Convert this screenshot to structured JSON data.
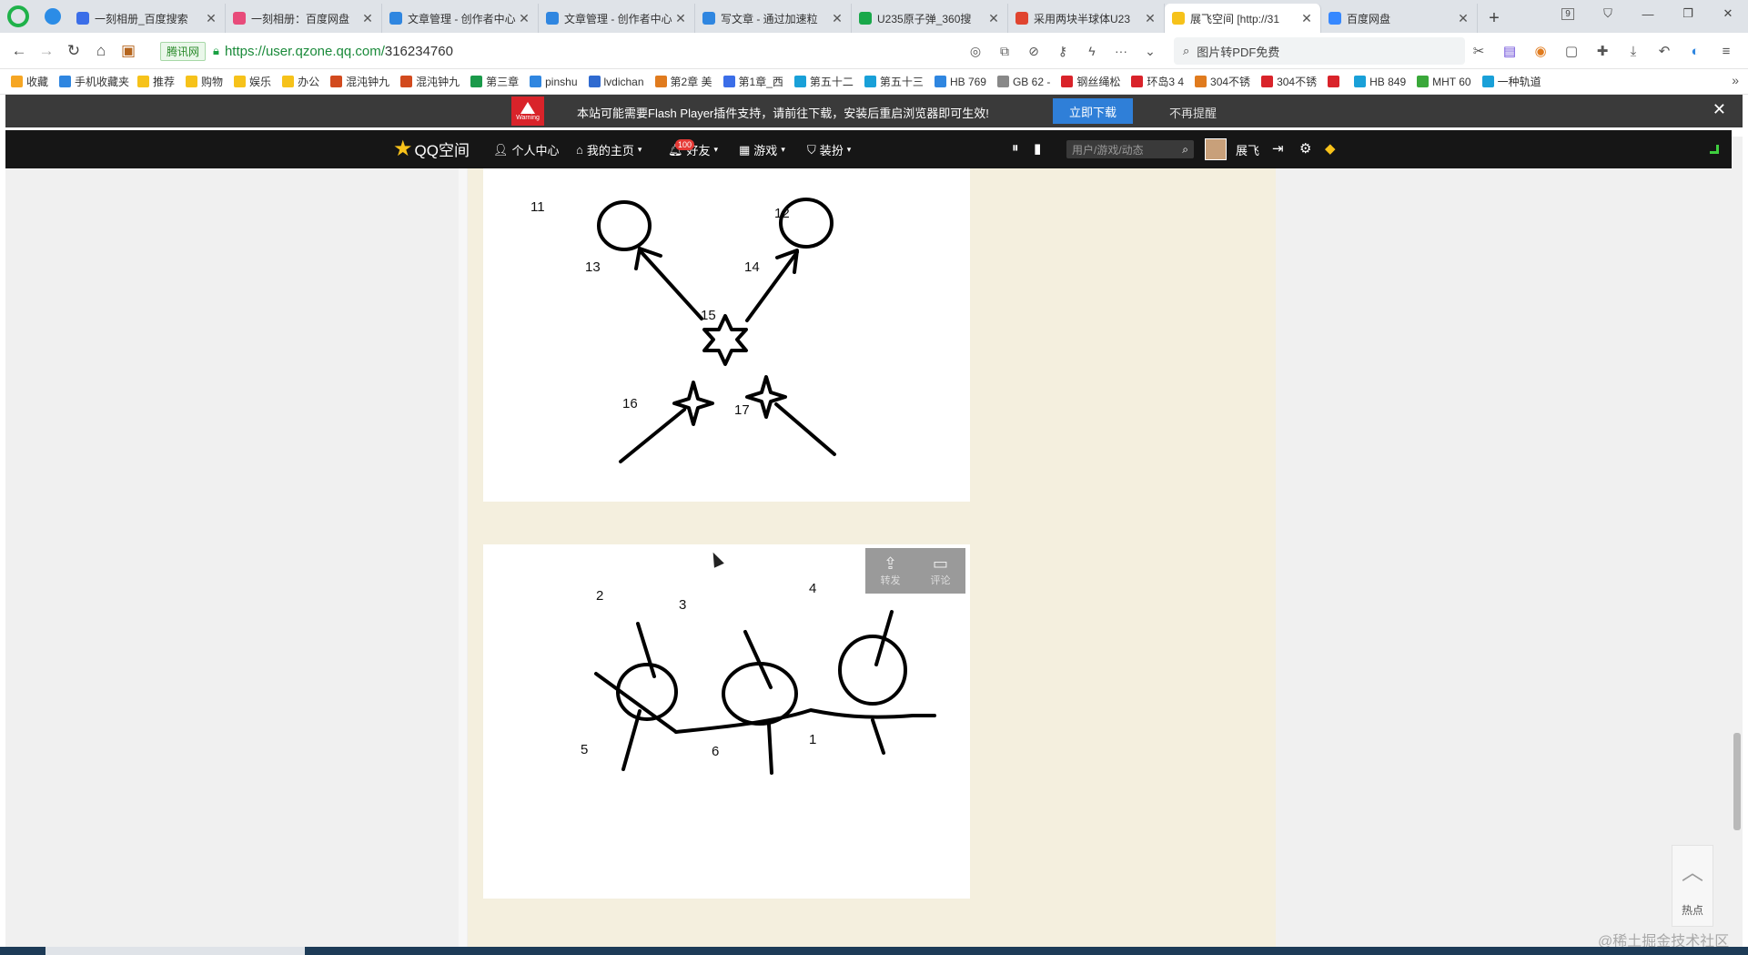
{
  "tabs": [
    {
      "title": "一刻相册_百度搜索",
      "color": "#3b6ee8",
      "active": false
    },
    {
      "title": "一刻相册：百度网盘",
      "color": "#e84b7a",
      "active": false
    },
    {
      "title": "文章管理 - 创作者中心",
      "color": "#2f86e0",
      "active": false
    },
    {
      "title": "文章管理 - 创作者中心",
      "color": "#2f86e0",
      "active": false
    },
    {
      "title": "写文章 - 通过加速粒",
      "color": "#2f86e0",
      "active": false
    },
    {
      "title": "U235原子弹_360搜",
      "color": "#19a84a",
      "active": false
    },
    {
      "title": "采用两块半球体U23",
      "color": "#e0442f",
      "active": false
    },
    {
      "title": "展飞空间 [http://31",
      "color": "#f6c21a",
      "active": true
    },
    {
      "title": "百度网盘",
      "color": "#3688ff",
      "active": false
    }
  ],
  "tab_counter": "9",
  "address": {
    "cert_label": "腾讯网",
    "url_host": "https://user.qzone.qq.com/",
    "url_path": "316234760",
    "search_text": "图片转PDF免费"
  },
  "bookmarks": [
    {
      "label": "收藏",
      "color": "#f6a623"
    },
    {
      "label": "手机收藏夹",
      "color": "#2f86e0"
    },
    {
      "label": "推荐",
      "color": "#f6c21a"
    },
    {
      "label": "购物",
      "color": "#f6c21a"
    },
    {
      "label": "娱乐",
      "color": "#f6c21a"
    },
    {
      "label": "办公",
      "color": "#f6c21a"
    },
    {
      "label": "混沌钟九",
      "color": "#d24a1e"
    },
    {
      "label": "混沌钟九",
      "color": "#d24a1e"
    },
    {
      "label": "第三章",
      "color": "#1a9a4a"
    },
    {
      "label": "pinshu",
      "color": "#2f86e0"
    },
    {
      "label": "lvdichan",
      "color": "#2f6ad0"
    },
    {
      "label": "第2章 美",
      "color": "#e07b1e"
    },
    {
      "label": "第1章_西",
      "color": "#3b6ee8"
    },
    {
      "label": "第五十二",
      "color": "#19a0d8"
    },
    {
      "label": "第五十三",
      "color": "#19a0d8"
    },
    {
      "label": "HB 769",
      "color": "#2f86e0"
    },
    {
      "label": "GB 62 -",
      "color": "#888888"
    },
    {
      "label": "钢丝绳松",
      "color": "#d9232a"
    },
    {
      "label": "环岛3 4",
      "color": "#d9232a"
    },
    {
      "label": "304不锈",
      "color": "#e07b1e"
    },
    {
      "label": "304不锈",
      "color": "#d9232a"
    },
    {
      "label": "",
      "color": "#d9232a"
    },
    {
      "label": "HB 849",
      "color": "#19a0d8"
    },
    {
      "label": "MHT 60",
      "color": "#3aa83a"
    },
    {
      "label": "一种轨道",
      "color": "#19a0d8"
    }
  ],
  "flash": {
    "badge": "Warning",
    "message": "本站可能需要Flash Player插件支持，请前往下载，安装后重启浏览器即可生效!",
    "download": "立即下载",
    "dismiss": "不再提醒",
    "close": "✕"
  },
  "qzone_nav": {
    "logo": "QQ空间",
    "personal_center": "个人中心",
    "my_home": "我的主页",
    "friends": "好友",
    "friends_badge": "100",
    "games": "游戏",
    "dress": "装扮",
    "search_placeholder": "用户/游戏/动态",
    "username": "展飞"
  },
  "figure1_labels": [
    "11",
    "12",
    "13",
    "14",
    "15",
    "16",
    "17"
  ],
  "figure2_labels": [
    "2",
    "3",
    "4",
    "5",
    "6",
    "1"
  ],
  "share": {
    "forward": "转发",
    "comment": "评论"
  },
  "side": {
    "hot": "热点"
  },
  "watermark": "@稀土掘金技术社区"
}
